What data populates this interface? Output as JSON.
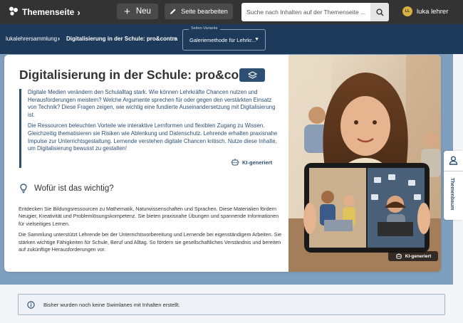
{
  "header": {
    "brand": "Themenseite",
    "new_label": "Neu",
    "edit_label": "Seite bearbeiten",
    "search_placeholder": "Suche nach Inhalten auf der Themenseite ...",
    "user_initials": "LL",
    "user_name": "luka lehrer"
  },
  "breadcrumb": {
    "items": [
      "lukalehrersammlung",
      "Digitalisierung in der Schule: pro&contra"
    ]
  },
  "variant": {
    "label": "Seiten-Variante",
    "value": "Galeriemethode für Lehrkr..."
  },
  "hero": {
    "title": "Digitalisierung in der Schule: pro&contra",
    "intro": [
      "Digitale Medien verändern den Schulalltag stark. Wie können Lehrkräfte Chancen nutzen und Herausforderungen meistern? Welche Argumente sprechen für oder gegen den verstärkten Einsatz von Technik? Diese Fragen zeigen, wie wichtig eine fundierte Auseinandersetzung mit Digitalisierung ist.",
      "Die Ressourcen beleuchten Vorteile wie interaktive Lernformen und flexiblen Zugang zu Wissen. Gleichzeitig thematisieren sie Risiken wie Ablenkung und Datenschutz. Lehrende erhalten praxisnahe Impulse zur Unterrichtsgestaltung. Lernende verstehen digitale Chancen kritisch. Nutze diese Inhalte, um Digitalisierung bewusst zu gestalten!"
    ],
    "ai_badge": "KI-generiert",
    "why_title": "Wofür ist das wichtig?",
    "why_text": [
      "Entdecken Sie Bildungsressourcen zu Mathematik, Naturwissenschaften und Sprachen. Diese Materialien fördern Neugier, Kreativität und Problemlösungskompetenz. Sie bieten praxisnahe Übungen und spannende Informationen für vielseitiges Lernen.",
      "Die Sammlung unterstützt Lehrende bei der Unterrichtsvorbereitung und Lernende bei eigenständigem Arbeiten. Sie stärken wichtige Fähigkeiten für Schule, Beruf und Alltag. So fördern sie gesellschaftliches Verständnis und bereiten auf zukünftige Herausforderungen vor."
    ],
    "image_ai_badge": "KI-generiert"
  },
  "sidetab": {
    "label": "Themenbaum"
  },
  "info": {
    "text": "Bisher wurden noch keine Swimlanes mit Inhalten erstellt."
  },
  "colors": {
    "topbar": "#333333",
    "breadcrumb_bar": "#1d3a5b",
    "band": "#7f9fbe",
    "accent": "#2c4f72"
  }
}
